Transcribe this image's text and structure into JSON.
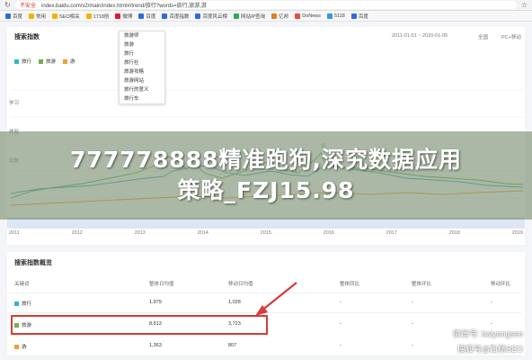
{
  "browser": {
    "insecure_label": "不安全",
    "url": "index.baidu.com/v2/main/index.html#/trend/旅行?words=旅行,旅游,游"
  },
  "bookmarks": [
    {
      "label": "百度",
      "color": "#2d6be4"
    },
    {
      "label": "常用",
      "color": "#f0b400"
    },
    {
      "label": "SEO相关",
      "color": "#f0b400"
    },
    {
      "label": "1718创",
      "color": "#f0b400"
    },
    {
      "label": "微博",
      "color": "#e6162d"
    },
    {
      "label": "百度",
      "color": "#2d6be4"
    },
    {
      "label": "百度指数",
      "color": "#2d6be4"
    },
    {
      "label": "百度风云榜",
      "color": "#2d6be4"
    },
    {
      "label": "网站IP查询",
      "color": "#27ae60"
    },
    {
      "label": "亿邦",
      "color": "#e67e22"
    },
    {
      "label": "DoNews",
      "color": "#e74c3c"
    },
    {
      "label": "5118",
      "color": "#3498db"
    },
    {
      "label": "百度",
      "color": "#2d6be4"
    }
  ],
  "search_index": {
    "title": "搜索指数",
    "date_range": "2011-01-01 ~ 2020-01-05",
    "region": "全国",
    "device": "PC+移动",
    "legend": [
      {
        "label": "旅行",
        "color": "#2fb8c9"
      },
      {
        "label": "旅游",
        "color": "#6ab344"
      },
      {
        "label": "游",
        "color": "#f0a030"
      }
    ],
    "side_labels": [
      "学习",
      "体验",
      "比较"
    ],
    "marker_b": "B",
    "marker_c": "C"
  },
  "dropdown_items": [
    "旅游师",
    "旅游",
    "旅行",
    "旅行社",
    "旅游攻略",
    "旅游网站",
    "旅行的意义",
    "旅行车"
  ],
  "banner": {
    "line1": "777778888精准跑狗,深究数据应用",
    "line2": "策略_FZJ15.98"
  },
  "timeline_years": [
    "2011",
    "2012",
    "2013",
    "2014",
    "2015",
    "2016",
    "2017",
    "2018",
    "2019"
  ],
  "overview": {
    "title": "搜索指数概览",
    "headers": [
      "关键词",
      "整体日均值",
      "移动日均值",
      "整体同比",
      "整体环比",
      "移动同比",
      "移动环比"
    ],
    "rows": [
      {
        "keyword": "旅行",
        "daily": "1,979",
        "mobile": "1,028",
        "yoy": "-",
        "mom": "-",
        "myoy": "-",
        "mmom": "-",
        "color": "#2fb8c9"
      },
      {
        "keyword": "旅游",
        "daily": "8,513",
        "mobile": "3,723",
        "yoy": "-",
        "mom": "-",
        "myoy": "-",
        "mmom": "-",
        "color": "#6ab344"
      },
      {
        "keyword": "游",
        "daily": "1,363",
        "mobile": "807",
        "yoy": "-",
        "mom": "-",
        "myoy": "-",
        "mmom": "-",
        "color": "#f0a030"
      }
    ]
  },
  "watermarks": {
    "wechat": "微信号: baiyangseo",
    "sohu": "搜狐号@白杨SEO"
  },
  "colors": {
    "annotation_red": "#d93a3a",
    "line_teal": "#2fb8c9",
    "line_green": "#6ab344",
    "line_orange": "#f0a030"
  }
}
